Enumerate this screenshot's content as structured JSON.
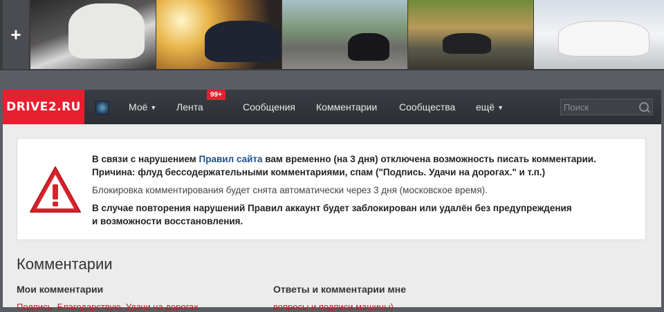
{
  "photo_strip": {
    "add_label": "+",
    "photos": [
      "car-photo-1",
      "car-photo-2",
      "car-photo-3",
      "car-photo-4",
      "car-photo-5"
    ]
  },
  "nav": {
    "logo": "DRIVE2.RU",
    "items": [
      {
        "label": "Моё",
        "dropdown": true
      },
      {
        "label": "Лента",
        "badge": "99+"
      },
      {
        "label": "Сообщения"
      },
      {
        "label": "Комментарии"
      },
      {
        "label": "Сообщества"
      },
      {
        "label": "ещё",
        "dropdown": true
      }
    ],
    "search_placeholder": "Поиск"
  },
  "warning": {
    "line1_pre": "В связи с нарушением ",
    "line1_link": "Правил сайта",
    "line1_post": " вам временно (на 3 дня) отключена возможность писать комментарии.",
    "line2": "Причина: флуд бессодержательными комментариями, спам (\"Подпись. Удачи на дорогах.\" и т.п.)",
    "line3": "Блокировка комментирования будет снята автоматически через 3 дня (московское время).",
    "line4": "В случае повторения нарушений Правил аккаунт будет заблокирован или удалён без предупреждения",
    "line5": "и возможности восстановления."
  },
  "comments": {
    "title": "Комментарии",
    "my_comments": "Мои комментарии",
    "replies": "Ответы и комментарии мне",
    "my_first_row": "Подпись. Благодарствую. Удачи на дорогах.",
    "reply_first_row": "вопросы и подписи машины)"
  },
  "colors": {
    "brand_red": "#e81f2f",
    "link_blue": "#1b4f8c",
    "nav_bg": "#2c2f34"
  }
}
